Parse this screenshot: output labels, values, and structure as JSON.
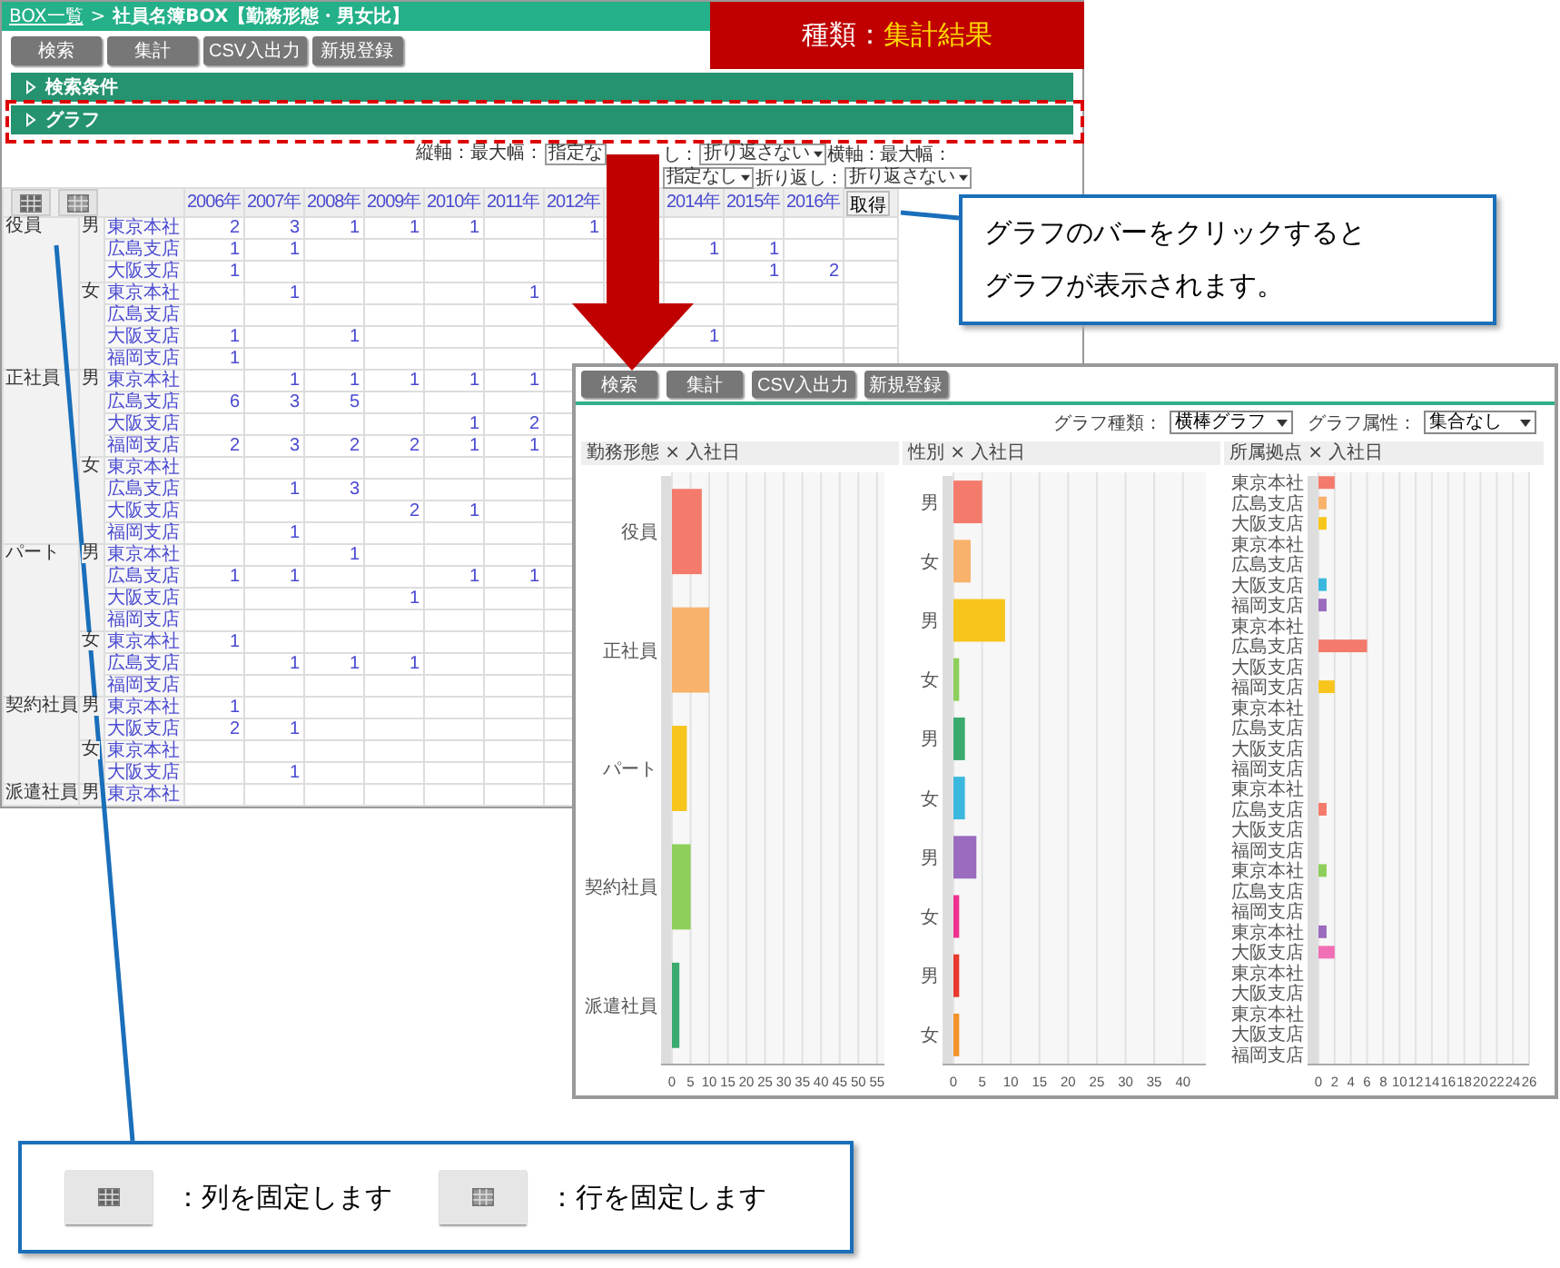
{
  "main_window": {
    "breadcrumb": {
      "link": "BOX一覧",
      "separator": ">",
      "current": "社員名簿BOX【勤務形態・男女比】"
    },
    "buttons": [
      "検索",
      "集計",
      "CSV入出力",
      "新規登録"
    ],
    "sections": [
      "検索条件",
      "グラフ"
    ],
    "axis_controls": [
      {
        "kind": "label",
        "text": "縦軸：最大幅："
      },
      {
        "kind": "select",
        "text": "指定な"
      },
      {
        "kind": "label",
        "text": "し："
      },
      {
        "kind": "select",
        "text": "折り返さない"
      },
      {
        "kind": "label",
        "text": "横軸：最大幅："
      },
      {
        "kind": "select",
        "text": "指定なし"
      },
      {
        "kind": "label",
        "text": "折り返し："
      },
      {
        "kind": "select",
        "text": "折り返さない"
      }
    ],
    "table": {
      "fix_buttons": [
        {
          "kind": "column"
        },
        {
          "kind": "row"
        }
      ],
      "columns": [
        "2006年",
        "2007年",
        "2008年",
        "2009年",
        "2010年",
        "2011年",
        "2012年",
        null,
        "2014年",
        "2015年",
        "2016年"
      ],
      "fetch_button": "取得",
      "groups": [
        {
          "label": "役員",
          "genders": [
            {
              "label": "男",
              "rows": [
                {
                  "branch": "東京本社",
                  "cells": [
                    "2",
                    "3",
                    "1",
                    "1",
                    "1",
                    null,
                    "1"
                  ]
                },
                {
                  "branch": "広島支店",
                  "cells": [
                    "1",
                    "1",
                    null,
                    null,
                    null,
                    null,
                    null,
                    null,
                    "1",
                    "1"
                  ]
                },
                {
                  "branch": "大阪支店",
                  "cells": [
                    "1",
                    null,
                    null,
                    null,
                    null,
                    null,
                    null,
                    null,
                    null,
                    "1",
                    "2"
                  ]
                }
              ]
            },
            {
              "label": "女",
              "rows": [
                {
                  "branch": "東京本社",
                  "cells": [
                    null,
                    "1",
                    null,
                    null,
                    null,
                    "1"
                  ]
                },
                {
                  "branch": "広島支店"
                },
                {
                  "branch": "大阪支店",
                  "cells": [
                    "1",
                    null,
                    "1",
                    null,
                    null,
                    null,
                    null,
                    null,
                    "1"
                  ]
                },
                {
                  "branch": "福岡支店",
                  "cells": [
                    "1"
                  ]
                }
              ]
            }
          ]
        },
        {
          "label": "正社員",
          "genders": [
            {
              "label": "男",
              "rows": [
                {
                  "branch": "東京本社",
                  "cells": [
                    null,
                    "1",
                    "1",
                    "1",
                    "1",
                    "1"
                  ]
                },
                {
                  "branch": "広島支店",
                  "cells": [
                    "6",
                    "3",
                    "5"
                  ]
                },
                {
                  "branch": "大阪支店",
                  "cells": [
                    null,
                    null,
                    null,
                    null,
                    "1",
                    "2"
                  ]
                },
                {
                  "branch": "福岡支店",
                  "cells": [
                    "2",
                    "3",
                    "2",
                    "2",
                    "1",
                    "1"
                  ]
                }
              ]
            },
            {
              "label": "女",
              "rows": [
                {
                  "branch": "東京本社"
                },
                {
                  "branch": "広島支店",
                  "cells": [
                    null,
                    "1",
                    "3"
                  ]
                },
                {
                  "branch": "大阪支店",
                  "cells": [
                    null,
                    null,
                    null,
                    "2",
                    "1"
                  ]
                },
                {
                  "branch": "福岡支店",
                  "cells": [
                    null,
                    "1"
                  ]
                }
              ]
            }
          ]
        },
        {
          "label": "パート",
          "genders": [
            {
              "label": "男",
              "rows": [
                {
                  "branch": "東京本社",
                  "cells": [
                    null,
                    null,
                    "1"
                  ]
                },
                {
                  "branch": "広島支店",
                  "cells": [
                    "1",
                    "1",
                    null,
                    null,
                    "1",
                    "1"
                  ]
                },
                {
                  "branch": "大阪支店",
                  "cells": [
                    null,
                    null,
                    null,
                    "1"
                  ]
                },
                {
                  "branch": "福岡支店"
                }
              ]
            },
            {
              "label": "女",
              "rows": [
                {
                  "branch": "東京本社",
                  "cells": [
                    "1"
                  ]
                },
                {
                  "branch": "広島支店",
                  "cells": [
                    null,
                    "1",
                    "1",
                    "1"
                  ]
                },
                {
                  "branch": "福岡支店"
                }
              ]
            }
          ]
        },
        {
          "label": "契約社員",
          "genders": [
            {
              "label": "男",
              "rows": [
                {
                  "branch": "東京本社",
                  "cells": [
                    "1"
                  ]
                },
                {
                  "branch": "大阪支店",
                  "cells": [
                    "2",
                    "1"
                  ]
                }
              ]
            },
            {
              "label": "女",
              "rows": [
                {
                  "branch": "東京本社"
                },
                {
                  "branch": "大阪支店",
                  "cells": [
                    null,
                    "1"
                  ]
                }
              ]
            }
          ]
        },
        {
          "label": "派遣社員",
          "genders": [
            {
              "label": "男",
              "rows": [
                {
                  "branch": "東京本社"
                }
              ]
            }
          ]
        }
      ]
    }
  },
  "banner": {
    "label": "種類：",
    "value": "集計結果"
  },
  "callout": {
    "lines": [
      "グラフのバーをクリックすると",
      "グラフが表示されます。"
    ]
  },
  "chart_window": {
    "buttons": [
      "検索",
      "集計",
      "CSV入出力",
      "新規登録"
    ],
    "controls": [
      {
        "label": "グラフ種類：",
        "value": "横棒グラフ"
      },
      {
        "label": "グラフ属性：",
        "value": "集合なし"
      }
    ],
    "charts": [
      {
        "chart_data": {
          "type": "bar",
          "orientation": "horizontal",
          "title": "勤務形態 × 入社日",
          "categories": [
            "役員",
            "正社員",
            "パート",
            "契約社員",
            "派遣社員"
          ],
          "series": [
            {
              "values": [
                8,
                10,
                4,
                5,
                2
              ]
            }
          ],
          "colors": [
            "#f47a6b",
            "#f9b26c",
            "#f8c51c",
            "#8dcf5a",
            "#3aaa6e"
          ],
          "grid": true,
          "xlim": [
            0,
            57
          ],
          "xticks": [
            0,
            5,
            10,
            15,
            20,
            25,
            30,
            35,
            40,
            45,
            50,
            55
          ]
        }
      },
      {
        "chart_data": {
          "type": "bar",
          "orientation": "horizontal",
          "title": "性別 × 入社日",
          "categories": [
            "男",
            "女",
            "男",
            "女",
            "男",
            "女",
            "男",
            "女",
            "男",
            "女"
          ],
          "series": [
            {
              "values": [
                5,
                3,
                9,
                1,
                2,
                2,
                4,
                1,
                1,
                1
              ]
            }
          ],
          "grid": true,
          "colors": [
            "#f47a6b",
            "#f9b26c",
            "#f8c51c",
            "#8dcf5a",
            "#3aaa6e",
            "#3ab8dd",
            "#9b6bbf",
            "#f0308f",
            "#e8372c",
            "#f5912a"
          ],
          "xlim": [
            0,
            44
          ],
          "xticks": [
            0,
            5,
            10,
            15,
            20,
            25,
            30,
            35,
            40
          ]
        }
      },
      {
        "chart_data": {
          "type": "bar",
          "orientation": "horizontal",
          "title": "所属拠点 × 入社日",
          "categories": [
            "東京本社",
            "広島支店",
            "大阪支店",
            "東京本社",
            "広島支店",
            "大阪支店",
            "福岡支店",
            "東京本社",
            "広島支店",
            "大阪支店",
            "福岡支店",
            "東京本社",
            "広島支店",
            "大阪支店",
            "福岡支店",
            "東京本社",
            "広島支店",
            "大阪支店",
            "福岡支店",
            "東京本社",
            "広島支店",
            "福岡支店",
            "東京本社",
            "大阪支店",
            "東京本社",
            "大阪支店",
            "東京本社",
            "大阪支店",
            "福岡支店"
          ],
          "grid": true,
          "series": [
            {
              "values": [
                2,
                1,
                1,
                0,
                0,
                1,
                1,
                0,
                6,
                0,
                2,
                0,
                0,
                0,
                0,
                0,
                1,
                0,
                0,
                1,
                0,
                0,
                1,
                2,
                0,
                0,
                0,
                0,
                0
              ]
            }
          ],
          "colors": [
            "#f47a6b",
            "#f9b26c",
            "#f8c51c",
            "#8dcf5a",
            "#3aaa6e",
            "#3ab8dd",
            "#9b6bbf",
            "#f06fb5"
          ],
          "xlim": [
            0,
            26
          ],
          "xticks": [
            0,
            2,
            4,
            6,
            8,
            10,
            12,
            14,
            16,
            18,
            20,
            22,
            24,
            26
          ]
        }
      }
    ]
  },
  "legend": {
    "items": [
      {
        "kind": "column",
        "text": "：列を固定します"
      },
      {
        "kind": "row",
        "text": "：行を固定します"
      }
    ]
  }
}
